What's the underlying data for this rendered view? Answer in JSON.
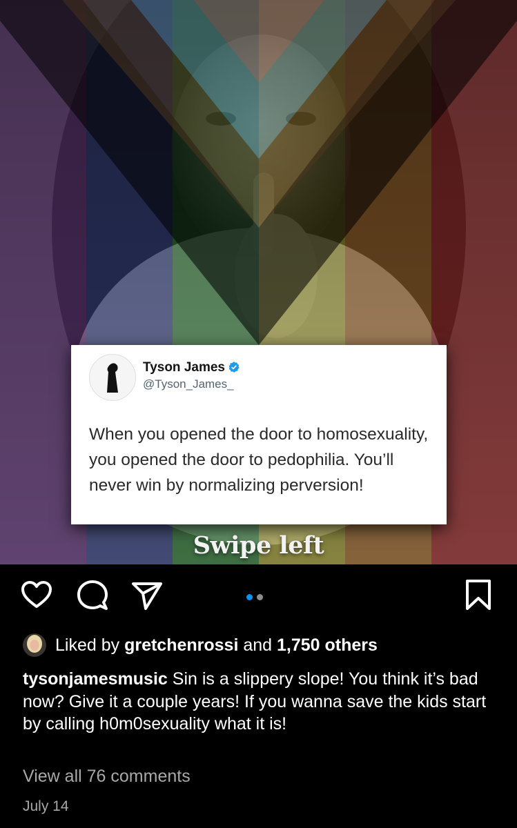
{
  "post": {
    "tweet": {
      "name": "Tyson James",
      "handle": "@Tyson_James_",
      "text": "When you opened the door to homosexuality, you opened the door to pedophilia. You’ll never win by normalizing perversion!"
    },
    "image_overlay_text": "Swipe left",
    "carousel": {
      "total": 2,
      "active_index": 0
    },
    "likes": {
      "prefix": "Liked by ",
      "user": "gretchenrossi",
      "middle": " and ",
      "count_text": "1,750 others"
    },
    "caption": {
      "username": "tysonjamesmusic",
      "text": " Sin is a slippery slope! You think it’s bad now? Give it a couple years! If you wanna save the kids start by calling h0m0sexuality what it is!"
    },
    "view_comments": "View all 76 comments",
    "date": "July 14"
  },
  "icons": {
    "like": "heart-icon",
    "comment": "comment-bubble-icon",
    "share": "paper-plane-icon",
    "save": "bookmark-icon",
    "verified": "verified-badge-icon"
  },
  "colors": {
    "background": "#000000",
    "carousel_active": "#0095f6",
    "carousel_inactive": "#8e8e8e",
    "verified": "#1d9bf0",
    "muted_text": "#a8a8a8"
  }
}
